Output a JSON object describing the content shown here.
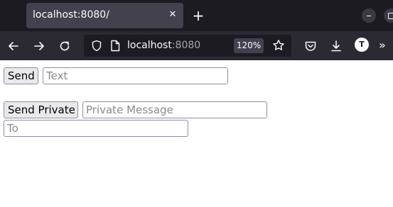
{
  "browser": {
    "tab": {
      "title": "localhost:8080/",
      "close_glyph": "✕"
    },
    "new_tab_glyph": "+",
    "url": {
      "host": "localhost",
      "port": ":8080"
    },
    "zoom": "120%",
    "account_initial": "T",
    "overflow_glyph": "»",
    "icons": [
      "back-arrow-icon",
      "forward-arrow-icon",
      "reload-icon",
      "shield-icon",
      "page-icon",
      "star-icon",
      "pocket-icon",
      "download-icon",
      "account-icon",
      "overflow-icon"
    ]
  },
  "form": {
    "send_label": "Send",
    "text_placeholder": "Text",
    "send_private_label": "Send Private",
    "private_placeholder": "Private Message",
    "to_placeholder": "To"
  },
  "colors": {
    "tab_strip": "#1c1b22",
    "toolbar": "#2b2a33",
    "active_tab": "#42414d",
    "button_bg": "#e9e9ed",
    "input_border": "#8f8f9d"
  }
}
